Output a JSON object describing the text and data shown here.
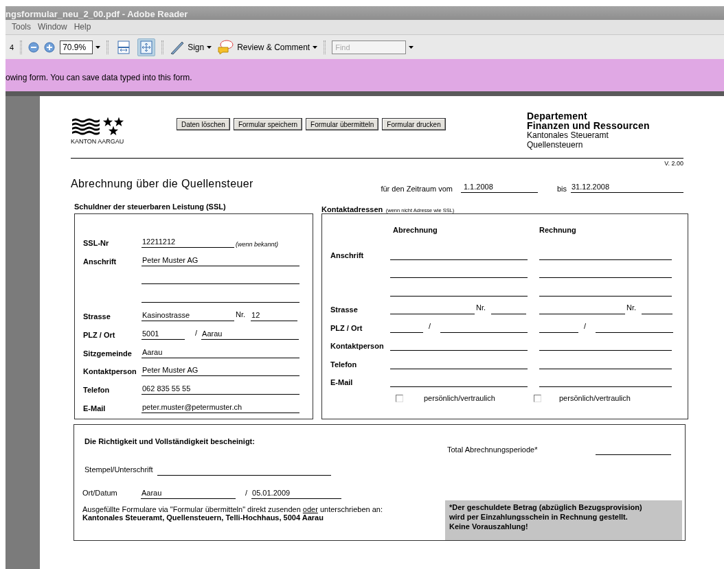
{
  "window": {
    "title": "ngsformular_neu_2_00.pdf - Adobe Reader"
  },
  "menu": [
    "Tools",
    "Window",
    "Help"
  ],
  "toolbar": [
    {
      "kind": "page",
      "text": "4"
    },
    {
      "kind": "separator"
    },
    {
      "kind": "zoom-out"
    },
    {
      "kind": "zoom-in"
    },
    {
      "kind": "zoom",
      "value": "70.9%"
    },
    {
      "kind": "separator"
    },
    {
      "kind": "fit-width",
      "selected": false
    },
    {
      "kind": "fit-page",
      "selected": true
    },
    {
      "kind": "separator"
    },
    {
      "kind": "sign",
      "label": "Sign"
    },
    {
      "kind": "review",
      "label": "Review & Comment"
    },
    {
      "kind": "separator"
    },
    {
      "kind": "find",
      "placeholder": "Find"
    }
  ],
  "banner": "owing form. You can save data typed into this form.",
  "form": {
    "logo_text": "KANTON AARGAU",
    "buttons": [
      "Daten löschen",
      "Formular speichern",
      "Formular übermitteln",
      "Formular drucken"
    ],
    "department": [
      {
        "text": "Departement",
        "bold": true
      },
      {
        "text": "Finanzen und Ressourcen",
        "bold": true
      },
      {
        "text": "Kantonales Steueramt",
        "bold": false
      },
      {
        "text": "Quellensteuern",
        "bold": false
      }
    ],
    "version": "V. 2.00",
    "title": "Abrechnung über die Quellensteuer",
    "period_label": "für den Zeitraum vom",
    "period_from": "1.1.2008",
    "period_to_label": "bis",
    "period_to": "31.12.2008"
  },
  "ssl": {
    "heading": "Schuldner der steuerbaren Leistung (SSL)",
    "rows": [
      {
        "kind": "field",
        "label": "SSL-Nr",
        "value": "12211212",
        "note": "(wenn bekannt)"
      },
      {
        "kind": "field",
        "label": "Anschrift",
        "value": "Peter Muster AG"
      },
      {
        "kind": "blank"
      },
      {
        "kind": "blank"
      },
      {
        "kind": "street",
        "label": "Strasse",
        "value": "Kasinostrasse",
        "nr_label": "Nr.",
        "nr": "12"
      },
      {
        "kind": "plz",
        "label": "PLZ / Ort",
        "plz": "5001",
        "sep": "/",
        "ort": "Aarau"
      },
      {
        "kind": "field",
        "label": "Sitzgemeinde",
        "value": "Aarau"
      },
      {
        "kind": "field",
        "label": "Kontaktperson",
        "value": "Peter Muster AG"
      },
      {
        "kind": "field",
        "label": "Telefon",
        "value": "062 835 55 55"
      },
      {
        "kind": "field",
        "label": "E-Mail",
        "value": "peter.muster@petermuster.ch"
      }
    ]
  },
  "contacts": {
    "heading": "Kontaktadressen",
    "note": "(wenn nicht Adresse wie SSL)",
    "columns": [
      {
        "title": "Abrechnung",
        "nr_label": "Nr.",
        "sep": "/",
        "confidential": {
          "label": "persönlich/vertraulich",
          "checked": false
        }
      },
      {
        "title": "Rechnung",
        "nr_label": "Nr.",
        "sep": "/",
        "confidential": {
          "label": "persönlich/vertraulich",
          "checked": false
        }
      }
    ],
    "rows": [
      {
        "kind": "field",
        "label": "Anschrift"
      },
      {
        "kind": "blank"
      },
      {
        "kind": "blank"
      },
      {
        "kind": "street",
        "label": "Strasse"
      },
      {
        "kind": "plz",
        "label": "PLZ / Ort"
      },
      {
        "kind": "field",
        "label": "Kontaktperson"
      },
      {
        "kind": "field",
        "label": "Telefon"
      },
      {
        "kind": "field",
        "label": "E-Mail"
      }
    ]
  },
  "certification": {
    "heading": "Die Richtigkeit und Vollständigkeit bescheinigt:",
    "signature_label": "Stempel/Unterschrift",
    "place_date_label": "Ort/Datum",
    "place": "Aarau",
    "sep": "/",
    "date": "05.01.2009",
    "instruction_before": "Ausgefüllte Formulare via \"Formular übermitteln\" direkt zusenden",
    "instruction_underlined": "oder",
    "instruction_after": "unterschrieben an:",
    "address": "Kantonales Steueramt, Quellensteuern, Telli-Hochhaus, 5004 Aarau",
    "total_label": "Total Abrechnungsperiode*",
    "note_lines": [
      "*Der geschuldete Betrag (abzüglich Bezugsprovision)",
      "wird per Einzahlungsschein in Rechnung gestellt.",
      "Keine Vorauszahlung!"
    ]
  }
}
